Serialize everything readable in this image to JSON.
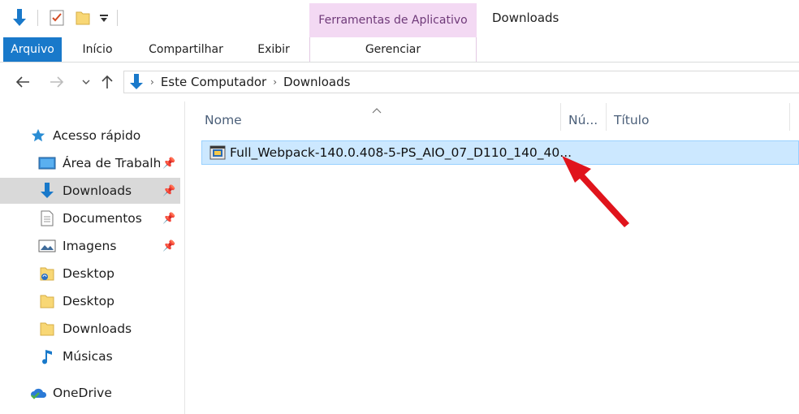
{
  "quick_access_toolbar": {
    "icons": [
      "down-arrow-icon",
      "properties-icon",
      "new-folder-icon",
      "customize-dropdown-icon"
    ]
  },
  "title_bar": {
    "context_tab_label": "Ferramentas de Aplicativo",
    "window_title": "Downloads"
  },
  "ribbon": {
    "tabs": [
      {
        "label": "Arquivo"
      },
      {
        "label": "Início"
      },
      {
        "label": "Compartilhar"
      },
      {
        "label": "Exibir"
      },
      {
        "label": "Gerenciar"
      }
    ],
    "accent_color": "#1979ca",
    "context_color": "#f3d9f3"
  },
  "address_bar": {
    "breadcrumbs": [
      "Este Computador",
      "Downloads"
    ]
  },
  "navigation_pane": {
    "quick_access_label": "Acesso rápido",
    "items": [
      {
        "label": "Área de Trabalho",
        "icon": "desktop-icon",
        "pinned": true
      },
      {
        "label": "Downloads",
        "icon": "downloads-icon",
        "pinned": true,
        "selected": true
      },
      {
        "label": "Documentos",
        "icon": "documents-icon",
        "pinned": true
      },
      {
        "label": "Imagens",
        "icon": "pictures-icon",
        "pinned": true
      },
      {
        "label": "Desktop",
        "icon": "desktop-sync-icon"
      },
      {
        "label": "Desktop",
        "icon": "folder-icon"
      },
      {
        "label": "Downloads",
        "icon": "folder-icon"
      },
      {
        "label": "Músicas",
        "icon": "music-icon"
      }
    ],
    "onedrive_label": "OneDrive"
  },
  "file_list": {
    "columns": [
      "Nome",
      "Nú...",
      "Título"
    ],
    "sorted_by": "Nome",
    "files": [
      {
        "name": "Full_Webpack-140.0.408-5-PS_AIO_07_D110_140_40...",
        "icon": "installer-icon",
        "selected": true
      }
    ]
  },
  "annotation": {
    "arrow_color": "#e0141c"
  }
}
